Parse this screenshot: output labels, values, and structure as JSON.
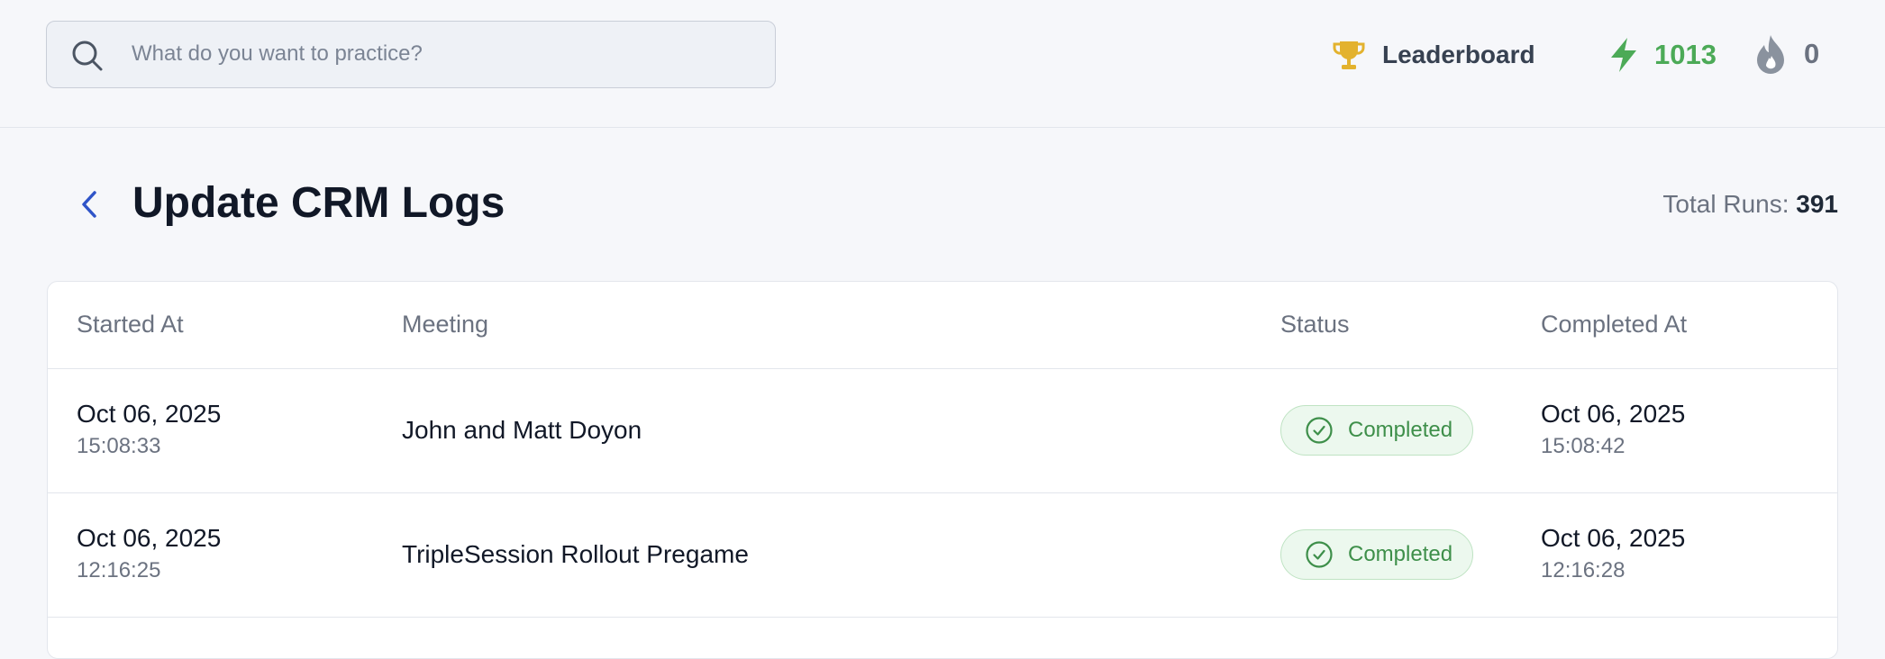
{
  "header": {
    "search": {
      "placeholder": "What do you want to practice?",
      "value": ""
    },
    "leaderboard_label": "Leaderboard",
    "points": "1013",
    "streak": "0",
    "colors": {
      "trophy": "#e3b22e",
      "points": "#4caa57",
      "streak_flame": "#8a929e"
    }
  },
  "page": {
    "title": "Update CRM Logs",
    "total_runs_label": "Total Runs:",
    "total_runs_value": "391"
  },
  "table": {
    "columns": [
      "Started At",
      "Meeting",
      "Status",
      "Completed At"
    ],
    "rows": [
      {
        "started_date": "Oct 06, 2025",
        "started_time": "15:08:33",
        "meeting": "John and Matt Doyon",
        "status": "Completed",
        "completed_date": "Oct 06, 2025",
        "completed_time": "15:08:42"
      },
      {
        "started_date": "Oct 06, 2025",
        "started_time": "12:16:25",
        "meeting": "TripleSession Rollout Pregame",
        "status": "Completed",
        "completed_date": "Oct 06, 2025",
        "completed_time": "12:16:28"
      }
    ]
  },
  "icons": {
    "search": "search-icon",
    "leaderboard": "trophy-icon",
    "points": "lightning-icon",
    "streak": "flame-icon",
    "back": "chevron-left-icon",
    "status": "check-circle-icon"
  }
}
